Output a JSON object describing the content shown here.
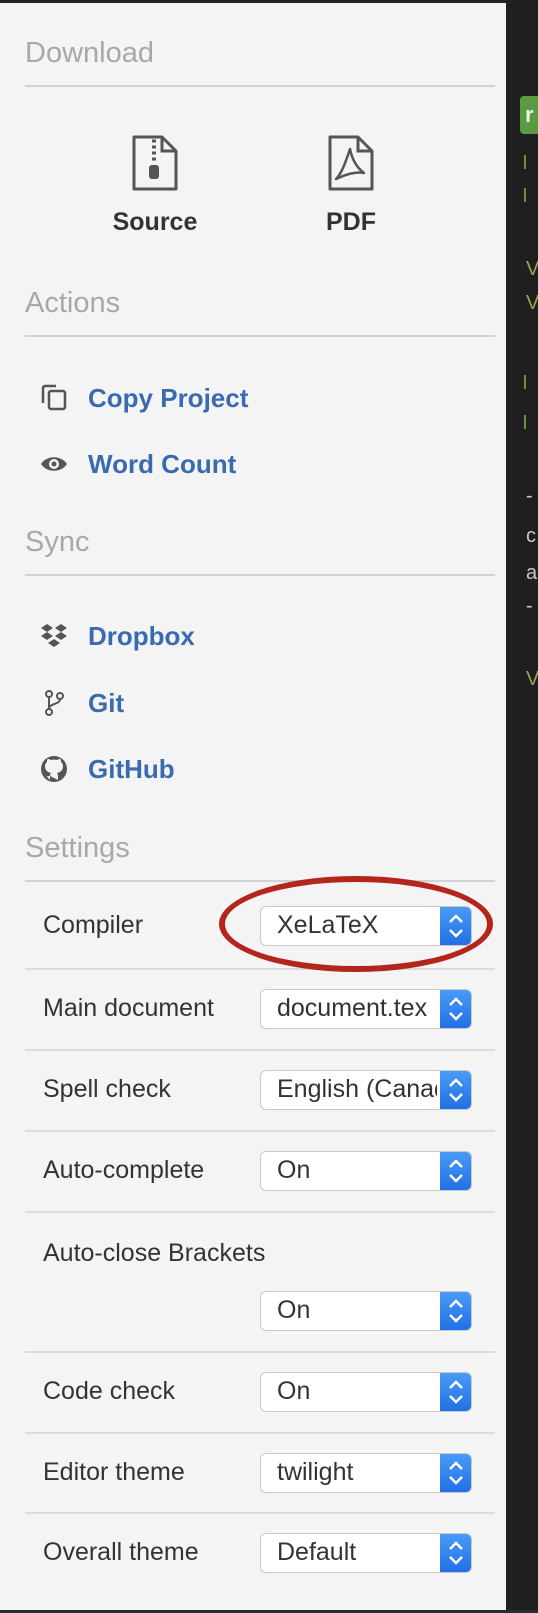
{
  "download": {
    "title": "Download",
    "items": [
      {
        "label": "Source",
        "icon": "zip-file-icon"
      },
      {
        "label": "PDF",
        "icon": "pdf-file-icon"
      }
    ]
  },
  "actions": {
    "title": "Actions",
    "items": [
      {
        "label": "Copy Project",
        "icon": "copy-icon"
      },
      {
        "label": "Word Count",
        "icon": "eye-icon"
      }
    ]
  },
  "sync": {
    "title": "Sync",
    "items": [
      {
        "label": "Dropbox",
        "icon": "dropbox-icon"
      },
      {
        "label": "Git",
        "icon": "git-branch-icon"
      },
      {
        "label": "GitHub",
        "icon": "github-icon"
      }
    ]
  },
  "settings": {
    "title": "Settings",
    "rows": [
      {
        "label": "Compiler",
        "value": "XeLaTeX"
      },
      {
        "label": "Main document",
        "value": "document.tex"
      },
      {
        "label": "Spell check",
        "value": "English (Canada)"
      },
      {
        "label": "Auto-complete",
        "value": "On"
      },
      {
        "label": "Auto-close Brackets",
        "value": "On"
      },
      {
        "label": "Code check",
        "value": "On"
      },
      {
        "label": "Editor theme",
        "value": "twilight"
      },
      {
        "label": "Overall theme",
        "value": "Default"
      }
    ]
  },
  "colors": {
    "link": "#3a6bb0",
    "section_title": "#a8a8a8",
    "select_button": "#1f6fe6",
    "annotation_ring": "#b4261c"
  }
}
